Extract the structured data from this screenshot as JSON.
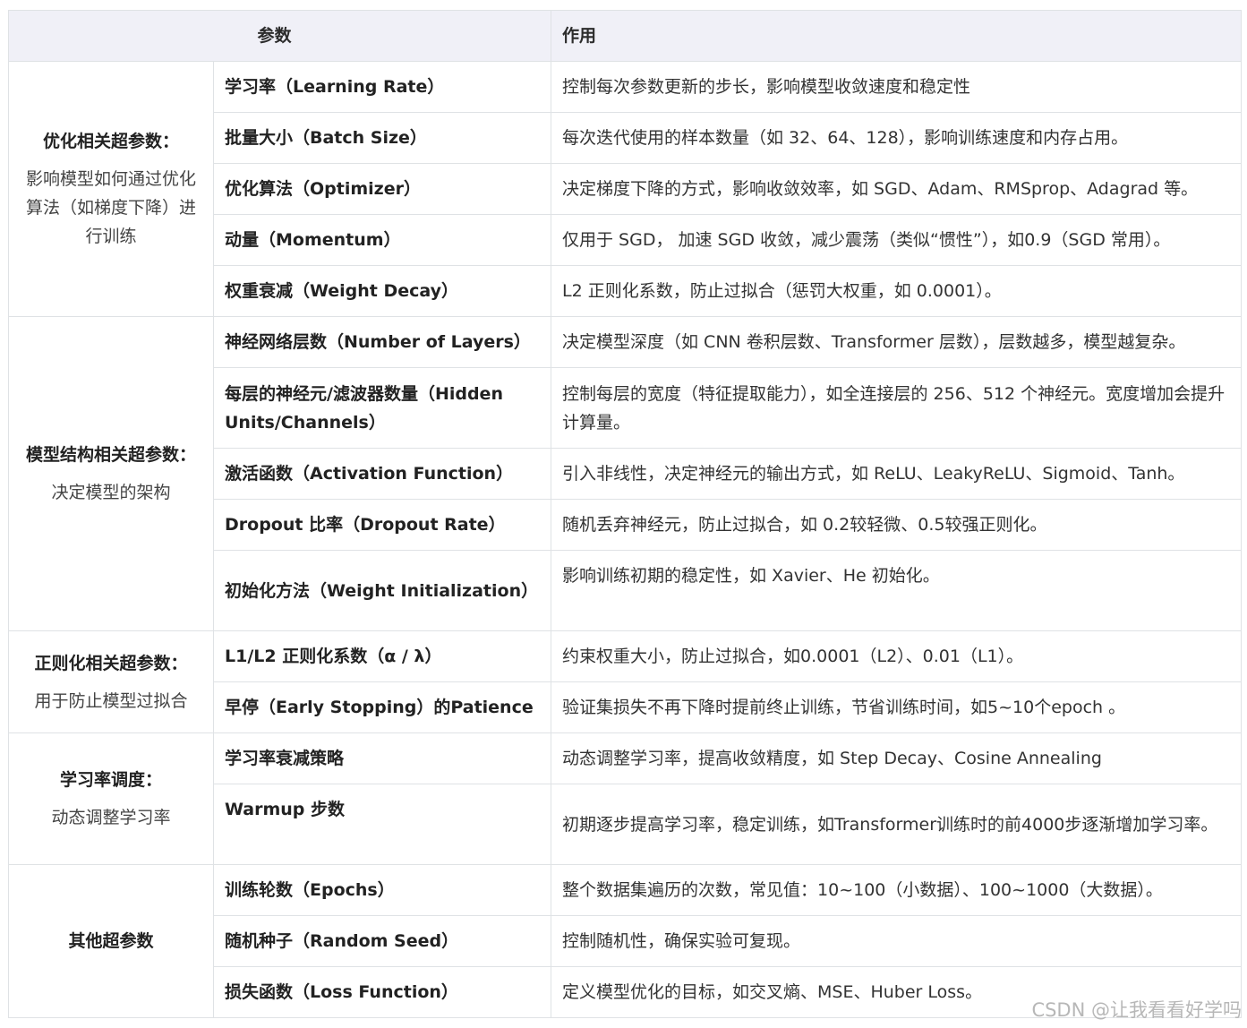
{
  "header": {
    "col_param": "参数",
    "col_effect": "作用"
  },
  "groups": [
    {
      "title": "优化相关超参数：",
      "desc": "影响模型如何通过优化算法（如梯度下降）进行训练",
      "rows": [
        {
          "param": "学习率（Learning Rate）",
          "effect": "控制每次参数更新的步长，影响模型收敛速度和稳定性"
        },
        {
          "param": "批量大小（Batch Size）",
          "effect": "每次迭代使用的样本数量（如 32、64、128），影响训练速度和内存占用。"
        },
        {
          "param": "优化算法（Optimizer）",
          "effect": "决定梯度下降的方式，影响收敛效率，如 SGD、Adam、RMSprop、Adagrad 等。"
        },
        {
          "param": "动量（Momentum）",
          "effect": "仅用于 SGD， 加速 SGD 收敛，减少震荡（类似“惯性”），如0.9（SGD 常用）。"
        },
        {
          "param": "权重衰减（Weight Decay）",
          "effect": " L2 正则化系数，防止过拟合（惩罚大权重，如 0.0001）。"
        }
      ]
    },
    {
      "title": "模型结构相关超参数：",
      "desc": "决定模型的架构",
      "rows": [
        {
          "param": "神经网络层数（Number of Layers）",
          "effect": "决定模型深度（如 CNN 卷积层数、Transformer 层数），层数越多，模型越复杂。"
        },
        {
          "param": "每层的神经元/滤波器数量（Hidden Units/Channels）",
          "effect": "控制每层的宽度（特征提取能力），如全连接层的 256、512 个神经元。宽度增加会提升计算量。"
        },
        {
          "param": "激活函数（Activation Function）",
          "effect": "引入非线性，决定神经元的输出方式，如 ReLU、LeakyReLU、Sigmoid、Tanh。"
        },
        {
          "param": "Dropout 比率（Dropout Rate）",
          "effect": "随机丢弃神经元，防止过拟合，如 0.2较轻微、0.5较强正则化。"
        },
        {
          "param": "初始化方法（Weight Initialization）",
          "effect": "影响训练初期的稳定性，如 Xavier、He 初始化。"
        }
      ]
    },
    {
      "title": "正则化相关超参数：",
      "desc": "用于防止模型过拟合",
      "rows": [
        {
          "param": "L1/L2 正则化系数（α / λ）",
          "effect": "约束权重大小，防止过拟合，如0.0001（L2）、0.01（L1）。"
        },
        {
          "param": "早停（Early Stopping）的Patience",
          "effect": "验证集损失不再下降时提前终止训练，节省训练时间，如5~10个epoch 。"
        }
      ]
    },
    {
      "title": "学习率调度：",
      "desc": "动态调整学习率",
      "rows": [
        {
          "param": "学习率衰减策略",
          "effect": "动态调整学习率，提高收敛精度，如 Step Decay、Cosine Annealing"
        },
        {
          "param": "Warmup 步数",
          "effect": "初期逐步提高学习率，稳定训练，如Transformer训练时的前4000步逐渐增加学习率。"
        }
      ]
    },
    {
      "title": "其他超参数",
      "desc": "",
      "rows": [
        {
          "param": "训练轮数（Epochs）",
          "effect": "整个数据集遍历的次数，常见值：10~100（小数据）、100~1000（大数据）。"
        },
        {
          "param": "随机种子（Random Seed）",
          "effect": "控制随机性，确保实验可复现。"
        },
        {
          "param": "损失函数（Loss Function）",
          "effect": "定义模型优化的目标，如交叉熵、MSE、Huber Loss。"
        }
      ]
    }
  ],
  "watermark": "CSDN @让我看看好学吗"
}
